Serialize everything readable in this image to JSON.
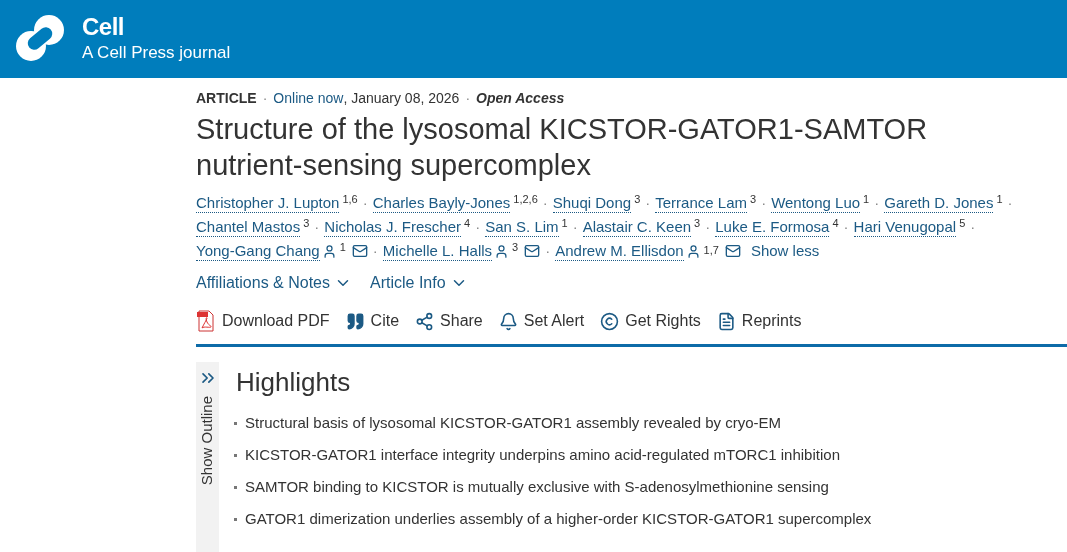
{
  "header": {
    "journal": "Cell",
    "subtitle": "A Cell Press journal"
  },
  "meta": {
    "type": "ARTICLE",
    "sep1": "·",
    "status": "Online now",
    "date": ", January 08, 2026",
    "sep2": "·",
    "access": "Open Access"
  },
  "title": "Structure of the lysosomal KICSTOR-GATOR1-SAMTOR nutrient-sensing supercomplex",
  "authors": [
    {
      "name": "Christopher J. Lupton",
      "sup": "1,6",
      "sep": "·"
    },
    {
      "name": "Charles Bayly-Jones",
      "sup": "1,2,6",
      "sep": "·"
    },
    {
      "name": "Shuqi Dong",
      "sup": "3",
      "sep": "·"
    },
    {
      "name": "Terrance Lam",
      "sup": "3",
      "sep": "·"
    },
    {
      "name": "Wentong Luo",
      "sup": "1",
      "sep": "·"
    },
    {
      "name": "Gareth D. Jones",
      "sup": "1",
      "sep": "·"
    },
    {
      "name": "Chantel Mastos",
      "sup": "3",
      "sep": "·"
    },
    {
      "name": "Nicholas J. Frescher",
      "sup": "4",
      "sep": "·"
    },
    {
      "name": "San S. Lim",
      "sup": "1",
      "sep": "·"
    },
    {
      "name": "Alastair C. Keen",
      "sup": "3",
      "sep": "·"
    },
    {
      "name": "Luke E. Formosa",
      "sup": "4",
      "sep": "·"
    },
    {
      "name": "Hari Venugopal",
      "sup": "5",
      "sep": "·"
    },
    {
      "name": "Yong-Gang Chang",
      "sup": "1",
      "corresponding": true,
      "email": true,
      "sep": "·"
    },
    {
      "name": "Michelle L. Halls",
      "sup": "3",
      "corresponding": true,
      "email": true,
      "sep": "·"
    },
    {
      "name": "Andrew M. Ellisdon",
      "sup": "1,7",
      "corresponding": true,
      "email": true
    }
  ],
  "show_less": "Show less",
  "dropdowns": [
    {
      "label": "Affiliations & Notes",
      "expanded": false
    },
    {
      "label": "Article Info",
      "expanded": false
    }
  ],
  "actions": [
    {
      "kind": "pdf",
      "label": "Download PDF"
    },
    {
      "kind": "cite",
      "label": "Cite"
    },
    {
      "kind": "share",
      "label": "Share"
    },
    {
      "kind": "alert",
      "label": "Set Alert"
    },
    {
      "kind": "rights",
      "label": "Get Rights"
    },
    {
      "kind": "reprints",
      "label": "Reprints"
    }
  ],
  "outline": {
    "label": "Show Outline"
  },
  "highlights": {
    "heading": "Highlights",
    "items": [
      "Structural basis of lysosomal KICSTOR-GATOR1 assembly revealed by cryo-EM",
      "KICSTOR-GATOR1 interface integrity underpins amino acid-regulated mTORC1 inhibition",
      "SAMTOR binding to KICSTOR is mutually exclusive with S-adenosylmethionine sensing",
      "GATOR1 dimerization underlies assembly of a higher-order KICSTOR-GATOR1 supercomplex"
    ]
  }
}
